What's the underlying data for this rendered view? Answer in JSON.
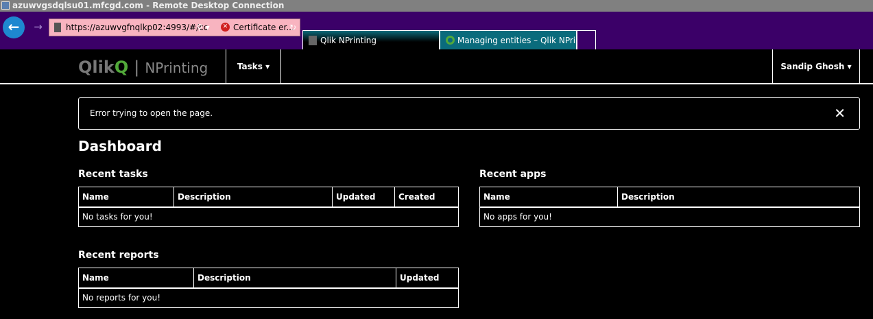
{
  "window": {
    "title": "azuwvgsdqlsu01.mfcgd.com - Remote Desktop Connection"
  },
  "browser": {
    "url": "https://azuwvgfnqlkp02:4993/#/co",
    "cert": "Certificate er...",
    "tabs": [
      {
        "label": "Qlik NPrinting"
      },
      {
        "label": "Managing entities – Qlik NPrin..."
      }
    ]
  },
  "nav": {
    "logo": "Qlik",
    "product": "NPrinting",
    "tasks": "Tasks",
    "user": "Sandip Ghosh"
  },
  "alert": {
    "message": "Error trying to open the page.",
    "close": "✕"
  },
  "page": {
    "title": "Dashboard"
  },
  "recent_tasks": {
    "title": "Recent tasks",
    "columns": [
      "Name",
      "Description",
      "Updated",
      "Created"
    ],
    "empty": "No tasks for you!"
  },
  "recent_apps": {
    "title": "Recent apps",
    "columns": [
      "Name",
      "Description"
    ],
    "empty": "No apps for you!"
  },
  "recent_reports": {
    "title": "Recent reports",
    "columns": [
      "Name",
      "Description",
      "Updated"
    ],
    "empty": "No reports for you!"
  }
}
